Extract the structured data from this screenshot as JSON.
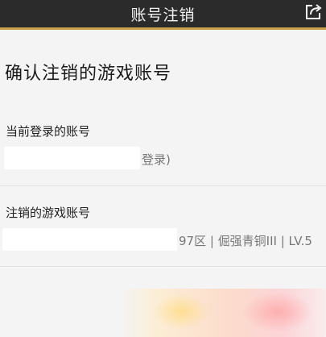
{
  "header": {
    "title": "账号注销",
    "share_icon": "share-icon"
  },
  "page": {
    "heading": "确认注销的游戏账号"
  },
  "current_account": {
    "label": "当前登录的账号",
    "value_suffix": "登录)"
  },
  "game_account": {
    "label": "注销的游戏账号",
    "value_suffix": "97区 | 倔强青铜III | LV.5"
  },
  "colors": {
    "header_bg": "#2b2b2b",
    "accent": "#c8a24a",
    "page_bg": "#f4f4f4"
  }
}
